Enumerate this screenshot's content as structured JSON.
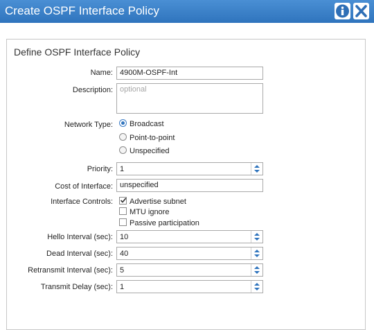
{
  "dialog": {
    "title": "Create OSPF Interface Policy",
    "info_icon": "info-icon",
    "close_icon": "close-icon"
  },
  "panel": {
    "title": "Define OSPF Interface Policy"
  },
  "form": {
    "name": {
      "label": "Name:",
      "value": "4900M-OSPF-Int"
    },
    "description": {
      "label": "Description:",
      "placeholder": "optional"
    },
    "network_type": {
      "label": "Network Type:",
      "options": [
        "Broadcast",
        "Point-to-point",
        "Unspecified"
      ],
      "selected": "Broadcast"
    },
    "priority": {
      "label": "Priority:",
      "value": "1"
    },
    "cost": {
      "label": "Cost of Interface:",
      "value": "unspecified"
    },
    "interface_controls": {
      "label": "Interface Controls:",
      "options": [
        {
          "label": "Advertise subnet",
          "checked": true
        },
        {
          "label": "MTU ignore",
          "checked": false
        },
        {
          "label": "Passive participation",
          "checked": false
        }
      ]
    },
    "hello_interval": {
      "label": "Hello Interval (sec):",
      "value": "10"
    },
    "dead_interval": {
      "label": "Dead Interval (sec):",
      "value": "40"
    },
    "retransmit_interval": {
      "label": "Retransmit Interval (sec):",
      "value": "5"
    },
    "transmit_delay": {
      "label": "Transmit Delay (sec):",
      "value": "1"
    }
  },
  "colors": {
    "titlebar": "#2f74bd",
    "accent": "#3a7bc6"
  }
}
